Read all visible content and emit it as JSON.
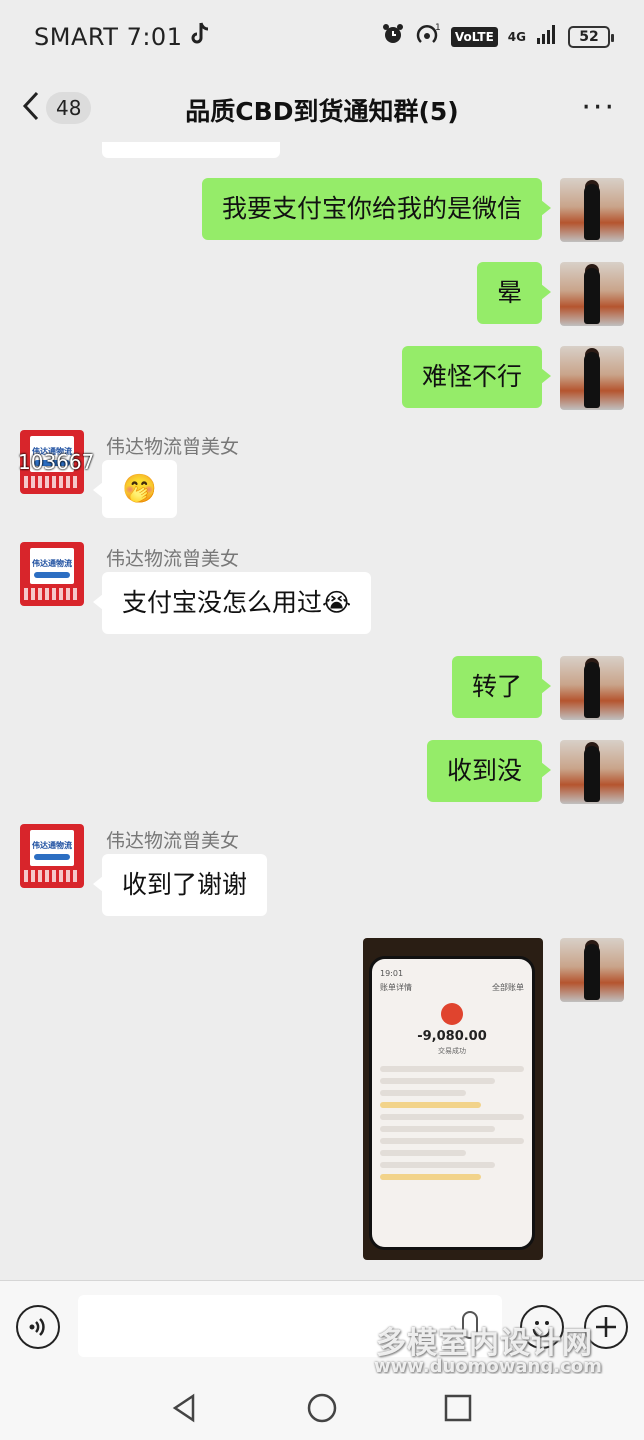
{
  "status_bar": {
    "carrier_time": "SMART 7:01",
    "volte": "VoLTE",
    "network": "4G",
    "battery": "52"
  },
  "nav": {
    "unread_count": "48",
    "title": "品质CBD到货通知群(5)",
    "more": "···"
  },
  "messages": [
    {
      "side": "me",
      "text": "我要支付宝你给我的是微信"
    },
    {
      "side": "me",
      "text": "晕"
    },
    {
      "side": "me",
      "text": "难怪不行"
    },
    {
      "side": "other",
      "sender": "伟达物流曾美女",
      "avatar_overlay": "103667",
      "text": "🤭"
    },
    {
      "side": "other",
      "sender": "伟达物流曾美女",
      "text": "支付宝没怎么用过😭"
    },
    {
      "side": "me",
      "text": "转了"
    },
    {
      "side": "me",
      "text": "收到没"
    },
    {
      "side": "other",
      "sender": "伟达物流曾美女",
      "text": "收到了谢谢"
    }
  ],
  "biz_avatar": {
    "logo_text": "伟达通物流"
  },
  "photo": {
    "phone_time": "19:01",
    "header_left": "账单详情",
    "header_right": "全部账单",
    "amount": "-9,080.00",
    "status": "交易成功"
  },
  "watermark": {
    "title": "多模室内设计网",
    "url": "www.duomowang.com"
  },
  "colors": {
    "my_bubble": "#95ec69",
    "other_bubble": "#ffffff",
    "background": "#ededed"
  }
}
